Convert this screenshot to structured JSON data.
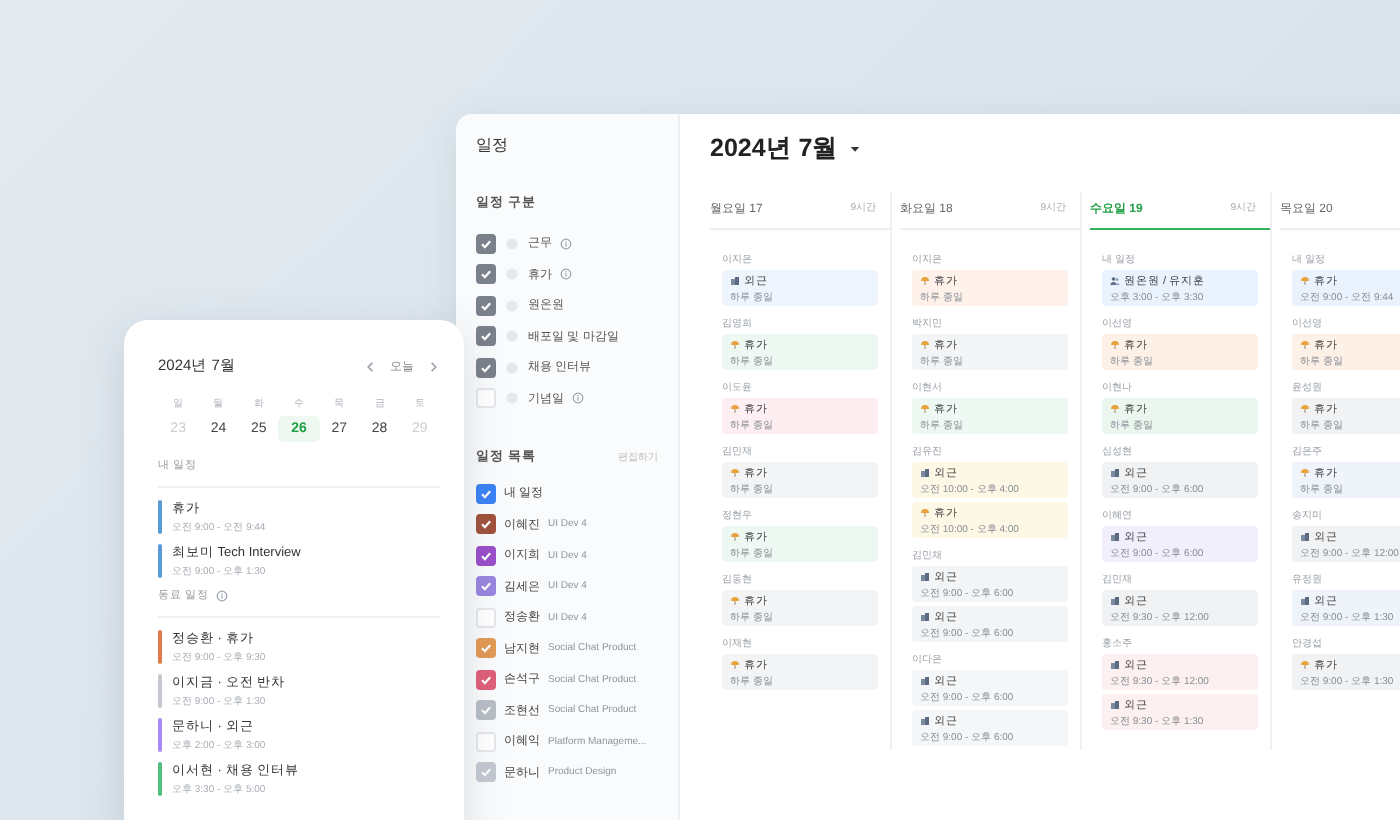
{
  "sidebar": {
    "title": "일정",
    "categories_heading": "일정 구분",
    "categories": [
      {
        "label": "근무",
        "checked": true,
        "info": true
      },
      {
        "label": "휴가",
        "checked": true,
        "info": true
      },
      {
        "label": "원온원",
        "checked": true,
        "info": false
      },
      {
        "label": "배포일 및 마감일",
        "checked": true,
        "info": false
      },
      {
        "label": "채용 인터뷰",
        "checked": true,
        "info": false
      },
      {
        "label": "기념일",
        "checked": false,
        "info": true
      }
    ],
    "list_heading": "일정 목록",
    "edit_link": "편집하기",
    "calendars": [
      {
        "name": "내 일정",
        "color": "#3b82f6",
        "checked": true
      },
      {
        "name": "이혜진",
        "team": "UI Dev 4",
        "color": "#a0523c",
        "checked": true
      },
      {
        "name": "이지희",
        "team": "UI Dev 4",
        "color": "#9b4fc9",
        "checked": true
      },
      {
        "name": "김세은",
        "team": "UI Dev 4",
        "color": "#9a86e0",
        "checked": true
      },
      {
        "name": "정송환",
        "team": "UI Dev 4",
        "checked": false
      },
      {
        "name": "남지현",
        "team": "Social Chat Product",
        "color": "#e39a55",
        "checked": true
      },
      {
        "name": "손석구",
        "team": "Social Chat Product",
        "color": "#e0607a",
        "checked": true
      },
      {
        "name": "조현선",
        "team": "Social Chat Product",
        "color": "#b9bec6",
        "checked": true
      },
      {
        "name": "이혜익",
        "team": "Platform Manageme...",
        "checked": false
      },
      {
        "name": "문하니",
        "team": "Product Design",
        "color": "#c4c9d0",
        "checked": true
      }
    ]
  },
  "main": {
    "title": "2024년 7월",
    "days": [
      {
        "label": "월요일 17",
        "hours": "9시간",
        "selected": false,
        "groups": [
          {
            "person": "이지은",
            "events": [
              {
                "kind": "outing",
                "title": "외근",
                "time": "하루 종일",
                "color": "#eef5fd"
              }
            ]
          },
          {
            "person": "김영희",
            "events": [
              {
                "kind": "vacation",
                "title": "휴가",
                "time": "하루 종일",
                "color": "#eef8f2"
              }
            ]
          },
          {
            "person": "이도윤",
            "events": [
              {
                "kind": "vacation",
                "title": "휴가",
                "time": "하루 종일",
                "color": "#fdeef1"
              }
            ]
          },
          {
            "person": "김민재",
            "events": [
              {
                "kind": "vacation",
                "title": "휴가",
                "time": "하루 종일",
                "color": "#f3f4f6"
              }
            ]
          },
          {
            "person": "정현우",
            "events": [
              {
                "kind": "vacation",
                "title": "휴가",
                "time": "하루 종일",
                "color": "#eef8f2"
              }
            ]
          },
          {
            "person": "김동현",
            "events": [
              {
                "kind": "vacation",
                "title": "휴가",
                "time": "하루 종일",
                "color": "#f3f4f6"
              }
            ]
          },
          {
            "person": "이재현",
            "events": [
              {
                "kind": "vacation",
                "title": "휴가",
                "time": "하루 종일",
                "color": "#f3f4f6"
              }
            ]
          }
        ]
      },
      {
        "label": "화요일 18",
        "hours": "9시간",
        "selected": false,
        "groups": [
          {
            "person": "이지은",
            "events": [
              {
                "kind": "vacation",
                "title": "휴가",
                "time": "하루 종일",
                "color": "#fdf1ea"
              }
            ]
          },
          {
            "person": "박지민",
            "events": [
              {
                "kind": "vacation",
                "title": "휴가",
                "time": "하루 종일",
                "color": "#f3f4f6"
              }
            ]
          },
          {
            "person": "이현서",
            "events": [
              {
                "kind": "vacation",
                "title": "휴가",
                "time": "하루 종일",
                "color": "#eef8f2"
              }
            ]
          },
          {
            "person": "김유진",
            "events": [
              {
                "kind": "outing",
                "title": "외근",
                "time": "오전 10:00 - 오후 4:00",
                "color": "#fdf7e6"
              },
              {
                "kind": "vacation",
                "title": "휴가",
                "time": "오전 10:00 - 오후 4:00",
                "color": "#fdf7e6"
              }
            ]
          },
          {
            "person": "김민채",
            "events": [
              {
                "kind": "outing",
                "title": "외근",
                "time": "오전 9:00 - 오후 6:00",
                "color": "#f3f4f6"
              },
              {
                "kind": "outing",
                "title": "외근",
                "time": "오전 9:00 - 오후 6:00",
                "color": "#f3f4f6"
              }
            ]
          },
          {
            "person": "이다은",
            "events": [
              {
                "kind": "outing",
                "title": "외근",
                "time": "오전 9:00 - 오후 6:00",
                "color": "#f5f6f8"
              },
              {
                "kind": "outing",
                "title": "외근",
                "time": "오전 9:00 - 오후 6:00",
                "color": "#f5f6f8"
              }
            ]
          }
        ]
      },
      {
        "label": "수요일 19",
        "hours": "9시간",
        "selected": true,
        "groups": [
          {
            "person": "내 일정",
            "events": [
              {
                "kind": "meeting",
                "title": "원온원 / 유지훈",
                "time": "오후 3:00 - 오후 3:30",
                "color": "#eaf3fd"
              }
            ]
          },
          {
            "person": "이선영",
            "events": [
              {
                "kind": "vacation",
                "title": "휴가",
                "time": "하루 종일",
                "color": "#fdf0e6"
              }
            ]
          },
          {
            "person": "이현나",
            "events": [
              {
                "kind": "vacation",
                "title": "휴가",
                "time": "하루 종일",
                "color": "#eaf6ee"
              }
            ]
          },
          {
            "person": "심성현",
            "events": [
              {
                "kind": "outing",
                "title": "외근",
                "time": "오전 9:00 - 오후 6:00",
                "color": "#f1f2f4"
              }
            ]
          },
          {
            "person": "이혜연",
            "events": [
              {
                "kind": "outing",
                "title": "외근",
                "time": "오전 9:00 - 오후 6:00",
                "color": "#f2effc"
              }
            ]
          },
          {
            "person": "김민재",
            "events": [
              {
                "kind": "outing",
                "title": "외근",
                "time": "오전 9:30 - 오후 12:00",
                "color": "#f1f2f4"
              }
            ]
          },
          {
            "person": "홍소주",
            "events": [
              {
                "kind": "outing",
                "title": "외근",
                "time": "오전 9:30 - 오후 12:00",
                "color": "#fdf0f0"
              },
              {
                "kind": "outing",
                "title": "외근",
                "time": "오전 9:30 - 오후 1:30",
                "color": "#fdf0f0"
              }
            ]
          }
        ]
      },
      {
        "label": "목요일 20",
        "selected": false,
        "groups": [
          {
            "person": "내 일정",
            "events": [
              {
                "kind": "vacation",
                "title": "휴가",
                "time": "오전 9:00 - 오전 9:44",
                "color": "#eaf3fd"
              }
            ]
          },
          {
            "person": "이선영",
            "events": [
              {
                "kind": "vacation",
                "title": "휴가",
                "time": "하루 종일",
                "color": "#fdf0e6"
              }
            ]
          },
          {
            "person": "윤성원",
            "events": [
              {
                "kind": "vacation",
                "title": "휴가",
                "time": "하루 종일",
                "color": "#f1f2f4"
              }
            ]
          },
          {
            "person": "김은주",
            "events": [
              {
                "kind": "vacation",
                "title": "휴가",
                "time": "하루 종일",
                "color": "#eff3fa"
              }
            ]
          },
          {
            "person": "송지미",
            "events": [
              {
                "kind": "outing",
                "title": "외근",
                "time": "오전 9:00 - 오후 12:00",
                "color": "#f1f2f4"
              }
            ]
          },
          {
            "person": "유정원",
            "events": [
              {
                "kind": "outing",
                "title": "외근",
                "time": "오전 9:00 - 오후 1:30",
                "color": "#eff3fa"
              }
            ]
          },
          {
            "person": "안경섭",
            "events": [
              {
                "kind": "vacation",
                "title": "휴가",
                "time": "오전 9:00 - 오후 1:30",
                "color": "#f1f2f4"
              }
            ]
          }
        ]
      }
    ]
  },
  "mobile": {
    "title": "2024년 7월",
    "today_button": "오늘",
    "weekdays": [
      "일",
      "월",
      "화",
      "수",
      "목",
      "금",
      "토"
    ],
    "dates": [
      {
        "label": "23",
        "selected": false,
        "muted": true
      },
      {
        "label": "24",
        "selected": false,
        "muted": false
      },
      {
        "label": "25",
        "selected": false,
        "muted": false
      },
      {
        "label": "26",
        "selected": true,
        "muted": false
      },
      {
        "label": "27",
        "selected": false,
        "muted": false
      },
      {
        "label": "28",
        "selected": false,
        "muted": false
      },
      {
        "label": "29",
        "selected": false,
        "muted": true
      }
    ],
    "sections": [
      {
        "heading": "내 일정",
        "info": false,
        "events": [
          {
            "title": "휴가",
            "time": "오전 9:00 - 오전 9:44",
            "color": "#5b9bd5"
          },
          {
            "title": "최보미 Tech Interview",
            "time": "오전 9:00 - 오후 1:30",
            "color": "#5b9bd5"
          }
        ]
      },
      {
        "heading": "동료 일정",
        "info": true,
        "events": [
          {
            "title": "정승환 · 휴가",
            "time": "오전 9:00 - 오후 9:30",
            "color": "#e07b4f"
          },
          {
            "title": "이지금 · 오전 반차",
            "time": "오전 9:00 - 오후 1:30",
            "color": "#c4c8ce"
          },
          {
            "title": "문하니 · 외근",
            "time": "오후 2:00 - 오후 3:00",
            "color": "#a78bfa"
          },
          {
            "title": "이서현 · 채용 인터뷰",
            "time": "오후 3:30 - 오후 5:00",
            "color": "#4fbf7f"
          }
        ]
      }
    ]
  }
}
